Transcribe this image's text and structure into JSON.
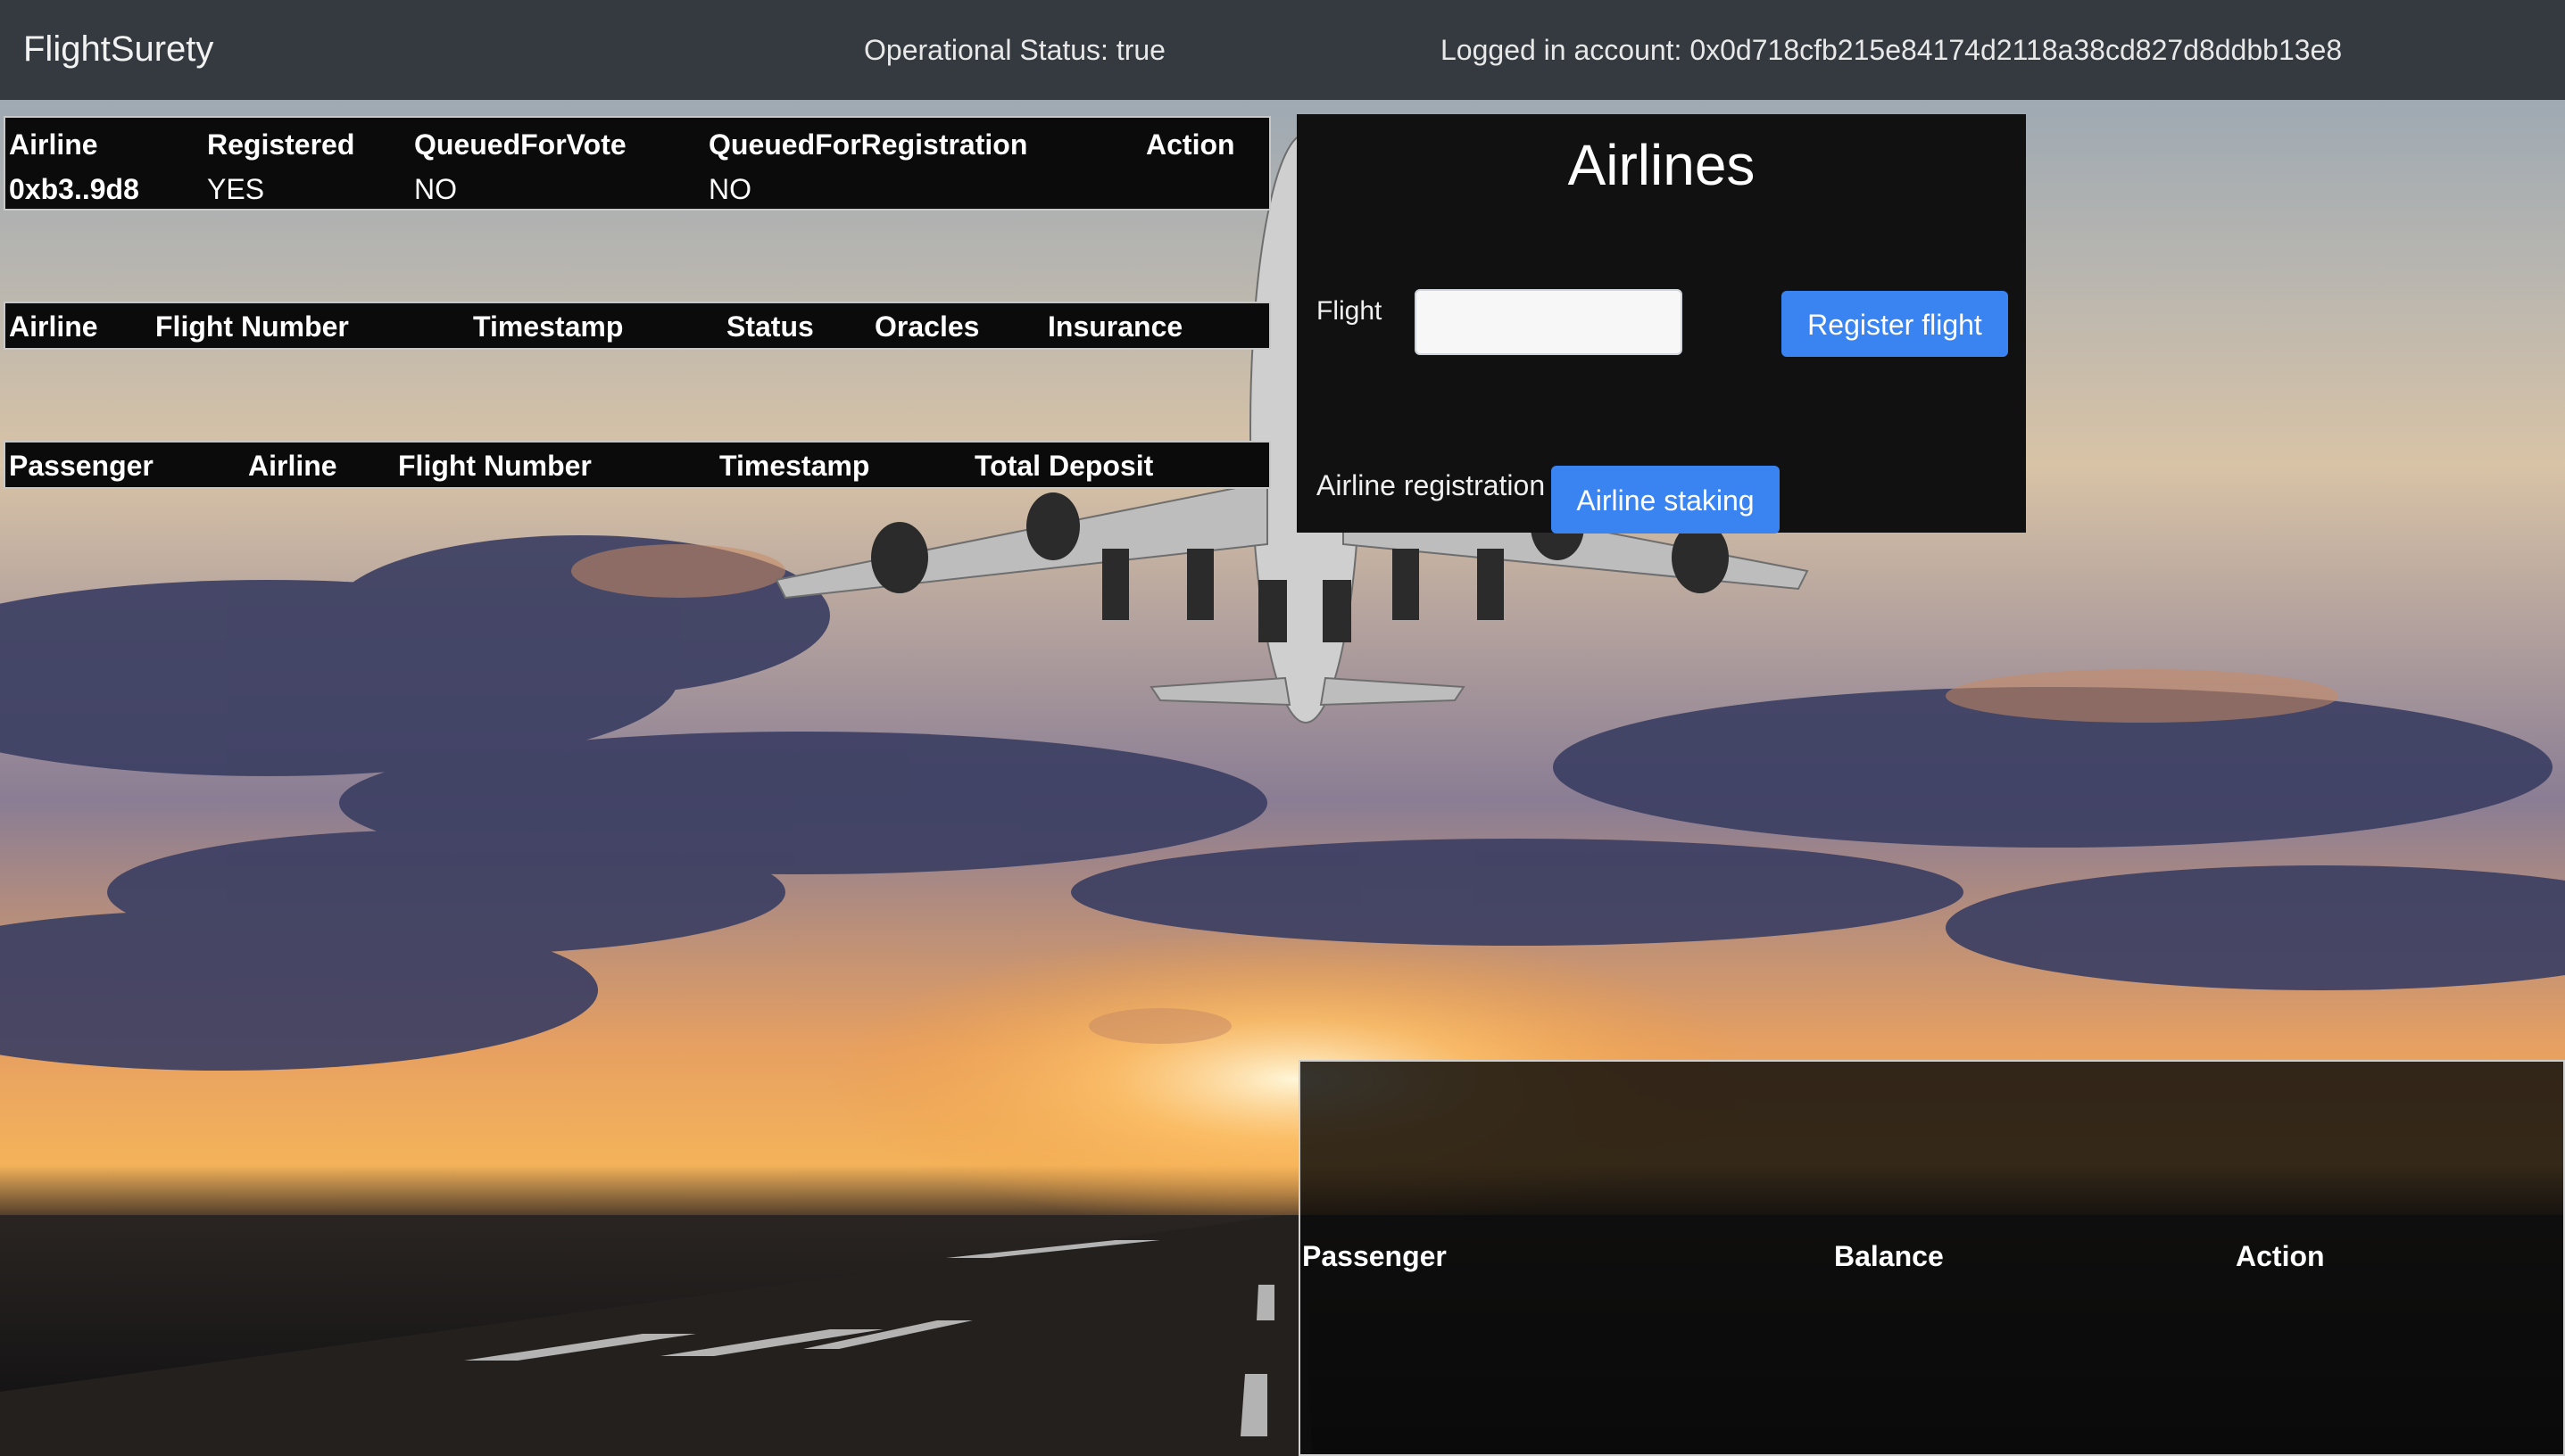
{
  "navbar": {
    "brand": "FlightSurety",
    "operational_status": "Operational Status: true",
    "account": "Logged in account: 0x0d718cfb215e84174d2118a38cd827d8ddbb13e8"
  },
  "airlines_table": {
    "headers": [
      "Airline",
      "Registered",
      "QueuedForVote",
      "QueuedForRegistration",
      "Action"
    ],
    "rows": [
      {
        "airline": "0xb3..9d8",
        "registered": "YES",
        "queued_for_vote": "NO",
        "queued_for_registration": "NO",
        "action": ""
      }
    ]
  },
  "flights_table": {
    "headers": [
      "Airline",
      "Flight Number",
      "Timestamp",
      "Status",
      "Oracles",
      "Insurance"
    ],
    "rows": []
  },
  "insurance_table": {
    "headers": [
      "Passenger",
      "Airline",
      "Flight Number",
      "Timestamp",
      "Total Deposit"
    ],
    "rows": []
  },
  "airlines_panel": {
    "title": "Airlines",
    "flight_label": "Flight",
    "flight_value": "",
    "register_flight_button": "Register flight",
    "airline_registration_label": "Airline registration",
    "airline_staking_button": "Airline staking"
  },
  "passenger_balance_table": {
    "headers": [
      "Passenger",
      "Balance",
      "Action"
    ],
    "rows": []
  },
  "colors": {
    "navbar": "#343a40",
    "primary_button": "#3a84f2",
    "table_background": "#0b0b0b"
  }
}
